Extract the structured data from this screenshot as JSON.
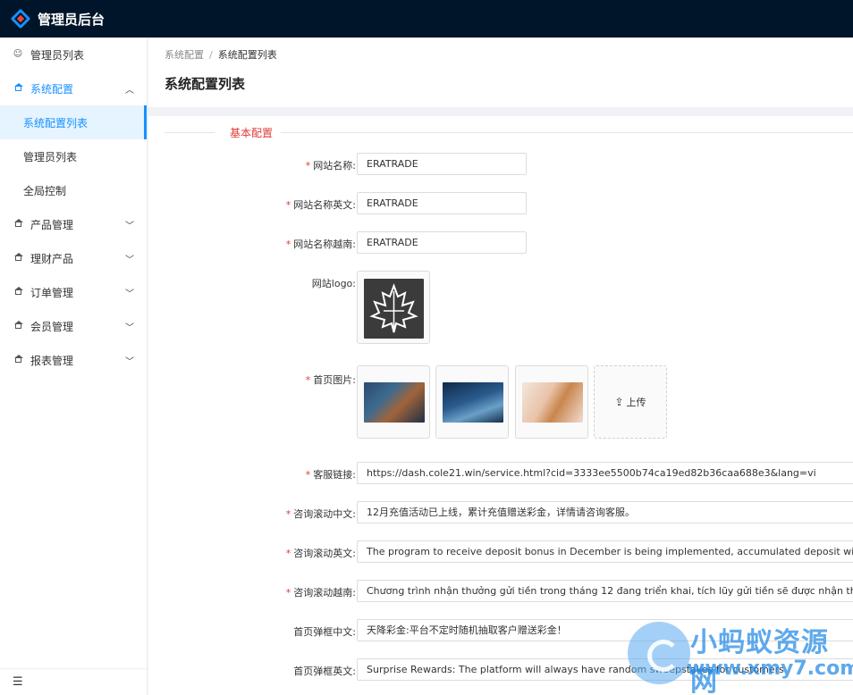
{
  "app": {
    "title": "管理员后台"
  },
  "sidebar": {
    "items": [
      {
        "label": "管理员列表",
        "icon": "smile-icon"
      },
      {
        "label": "系统配置",
        "icon": "home-icon",
        "open": true,
        "children": [
          {
            "label": "系统配置列表",
            "active": true
          },
          {
            "label": "管理员列表"
          },
          {
            "label": "全局控制"
          }
        ]
      },
      {
        "label": "产品管理",
        "icon": "home-icon"
      },
      {
        "label": "理财产品",
        "icon": "home-icon"
      },
      {
        "label": "订单管理",
        "icon": "home-icon"
      },
      {
        "label": "会员管理",
        "icon": "home-icon"
      },
      {
        "label": "报表管理",
        "icon": "home-icon"
      }
    ],
    "collapse_icon": "menu-fold-icon"
  },
  "breadcrumb": {
    "parent": "系统配置",
    "separator": "/",
    "current": "系统配置列表"
  },
  "page": {
    "title": "系统配置列表"
  },
  "form": {
    "section_title": "基本配置",
    "site_name": {
      "label": "网站名称:",
      "value": "ERATRADE",
      "required": true
    },
    "site_name_en": {
      "label": "网站名称英文:",
      "value": "ERATRADE",
      "required": true
    },
    "site_name_vn": {
      "label": "网站名称越南:",
      "value": "ERATRADE",
      "required": true
    },
    "site_logo": {
      "label": "网站logo:",
      "required": false
    },
    "home_images": {
      "label": "首页图片:",
      "required": true,
      "upload_label": "上传"
    },
    "service_link": {
      "label": "客服链接:",
      "value": "https://dash.cole21.win/service.html?cid=3333ee5500b74ca19ed82b36caa688e3&lang=vi",
      "required": true
    },
    "ticker_cn": {
      "label": "咨询滚动中文:",
      "value": "12月充值活动已上线，累计充值赠送彩金，详情请咨询客服。",
      "required": true
    },
    "ticker_en": {
      "label": "咨询滚动英文:",
      "value": "The program to receive deposit bonus in December is being implemented, accumulated deposit will be rewarded",
      "required": true
    },
    "ticker_vn": {
      "label": "咨询滚动越南:",
      "value": "Chương trình nhận thưởng gửi tiền trong tháng 12 đang triển khai, tích lũy gửi tiền sẽ được nhận thưởng, để biết",
      "required": true
    },
    "popup_cn": {
      "label": "首页弹框中文:",
      "value": "天降彩金:平台不定时随机抽取客户赠送彩金！",
      "required": false
    },
    "popup_en": {
      "label": "首页弹框英文:",
      "value": "Surprise Rewards: The platform will always have random sweepstakes for customers",
      "required": false
    }
  },
  "watermark": {
    "text": "小蚂蚁资源网",
    "url": "www.xmy7.com"
  },
  "colors": {
    "accent": "#1890ff",
    "topbar": "#001529",
    "required": "#e03a3a"
  }
}
